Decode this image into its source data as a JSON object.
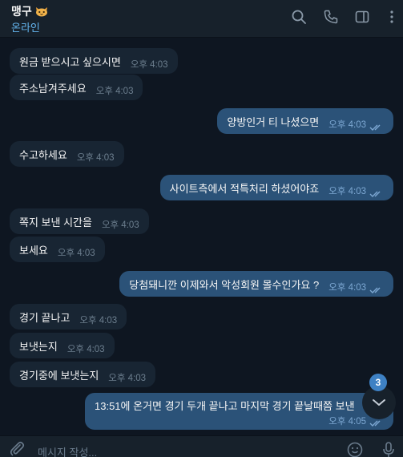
{
  "header": {
    "chat_name": "맹구",
    "status": "온라인",
    "icons": [
      "search-icon",
      "phone-icon",
      "sidebar-toggle-icon",
      "more-icon"
    ]
  },
  "messages": [
    {
      "dir": "in",
      "text": "원금 받으시고 싶으시면",
      "time": "오후 4:03"
    },
    {
      "dir": "in",
      "text": "주소남겨주세요",
      "time": "오후 4:03"
    },
    {
      "dir": "out",
      "text": "양방인거 티 나셨으면",
      "time": "오후 4:03",
      "read": true
    },
    {
      "dir": "in",
      "text": "수고하세요",
      "time": "오후 4:03"
    },
    {
      "dir": "out",
      "text": "사이트측에서 적특처리 하셨어야죠",
      "time": "오후 4:03",
      "read": true
    },
    {
      "dir": "in",
      "text": "쪽지 보낸 시간을",
      "time": "오후 4:03"
    },
    {
      "dir": "in",
      "text": "보세요",
      "time": "오후 4:03"
    },
    {
      "dir": "out",
      "text": "당첨돼니깐 이제와서 악성회원 몰수인가요 ?",
      "time": "오후 4:03",
      "read": true
    },
    {
      "dir": "in",
      "text": "경기 끝나고",
      "time": "오후 4:03"
    },
    {
      "dir": "in",
      "text": "보냇는지",
      "time": "오후 4:03"
    },
    {
      "dir": "in",
      "text": "경기중에 보냇는지",
      "time": "오후 4:03"
    },
    {
      "dir": "out",
      "text": "13:51에 온거면 경기 두개 끝나고 마지막 경기 끝날때쯤 보낸",
      "time": "오후 4:05",
      "read": true
    }
  ],
  "scroll": {
    "unread_count": "3"
  },
  "composer": {
    "placeholder": "메시지 작성..."
  },
  "colors": {
    "background": "#0e1621",
    "header": "#17212b",
    "incoming_bubble": "#182533",
    "outgoing_bubble": "#2b5278",
    "accent": "#64b5ef",
    "badge": "#3e81c4"
  }
}
